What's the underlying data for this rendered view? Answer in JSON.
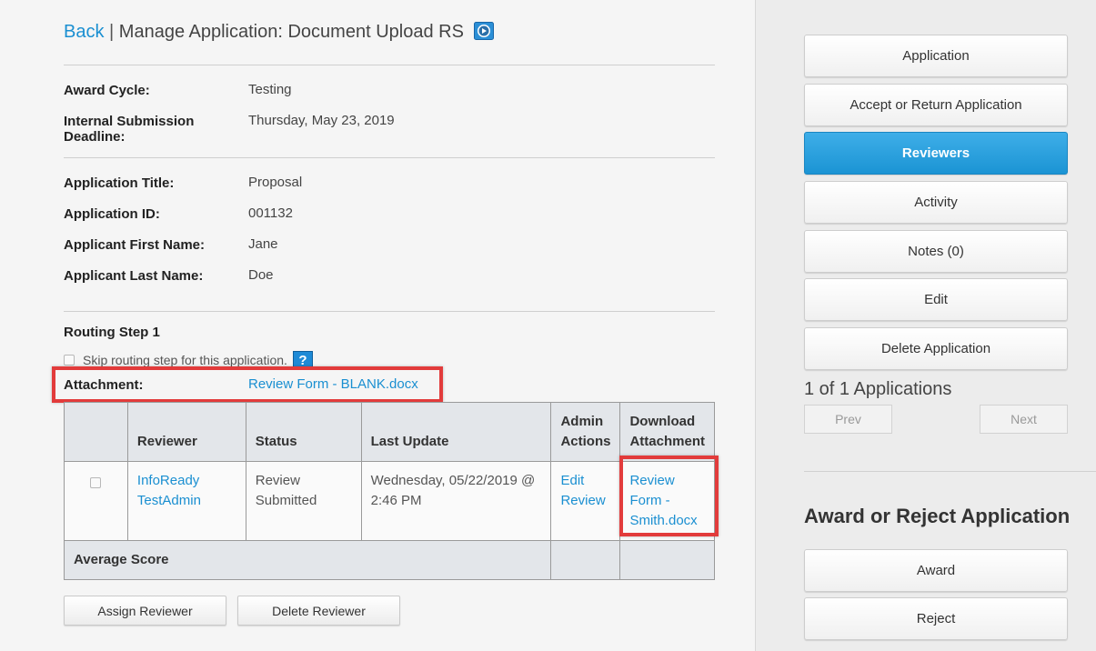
{
  "header": {
    "back_label": "Back",
    "separator": "|",
    "title": "Manage Application: Document Upload RS"
  },
  "details": {
    "award_cycle_label": "Award Cycle:",
    "award_cycle_value": "Testing",
    "deadline_label": "Internal Submission Deadline:",
    "deadline_value": "Thursday, May 23, 2019",
    "app_title_label": "Application Title:",
    "app_title_value": "Proposal",
    "app_id_label": "Application ID:",
    "app_id_value": "001132",
    "first_name_label": "Applicant First Name:",
    "first_name_value": "Jane",
    "last_name_label": "Applicant Last Name:",
    "last_name_value": "Doe"
  },
  "routing": {
    "step_label": "Routing Step 1",
    "skip_label": "Skip routing step for this application.",
    "help_glyph": "?",
    "attachment_label": "Attachment:",
    "attachment_link": "Review Form - BLANK.docx"
  },
  "table": {
    "headers": [
      "",
      "Reviewer",
      "Status",
      "Last Update",
      "Admin Actions",
      "Download Attachment"
    ],
    "rows": [
      {
        "reviewer": "InfoReady TestAdmin",
        "status": "Review Submitted",
        "last_update": "Wednesday, 05/22/2019 @ 2:46 PM",
        "admin_action": "Edit Review",
        "download": "Review Form - Smith.docx"
      }
    ],
    "average_label": "Average Score"
  },
  "actions": {
    "assign_label": "Assign Reviewer",
    "delete_label": "Delete Reviewer"
  },
  "sidebar": {
    "buttons": [
      {
        "label": "Application",
        "active": false
      },
      {
        "label": "Accept or Return Application",
        "active": false
      },
      {
        "label": "Reviewers",
        "active": true
      },
      {
        "label": "Activity",
        "active": false
      },
      {
        "label": "Notes (0)",
        "active": false
      },
      {
        "label": "Edit",
        "active": false
      },
      {
        "label": "Delete Application",
        "active": false
      }
    ],
    "count_text": "1 of 1 Applications",
    "prev_label": "Prev",
    "next_label": "Next",
    "award_title": "Award or Reject Application",
    "award_label": "Award",
    "reject_label": "Reject"
  },
  "colors": {
    "link": "#1a8fd1",
    "active_button": "#1b94d4",
    "highlight": "#e23b3b"
  },
  "icons": {
    "title_icon": "play-video-icon",
    "help_icon": "question-mark-icon"
  }
}
